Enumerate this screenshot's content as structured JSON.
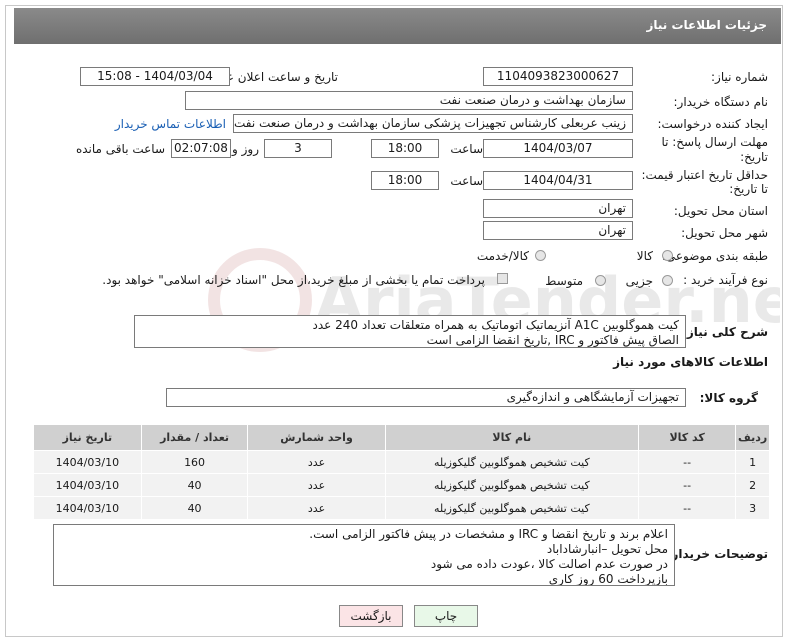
{
  "header": {
    "title": "جزئیات اطلاعات نیاز"
  },
  "form": {
    "need_number_label": "شماره نیاز:",
    "need_number": "1104093823000627",
    "announce_label": "تاریخ و ساعت اعلان عمومی:",
    "announce_value": "1404/03/04 - 15:08",
    "buyer_org_label": "نام دستگاه خریدار:",
    "buyer_org": "سازمان بهداشت و درمان صنعت نفت",
    "creator_label": "ایجاد کننده درخواست:",
    "creator": "زینب عربعلی کارشناس تجهیزات پزشکی سازمان بهداشت و درمان صنعت نفت",
    "contact_link": "اطلاعات تماس خریدار",
    "deadline_label_1": "مهلت ارسال پاسخ: تا",
    "deadline_label_2": "تاریخ:",
    "deadline_date": "1404/03/07",
    "time_label": "ساعت",
    "deadline_time": "18:00",
    "days_value": "3",
    "days_label": "روز و",
    "remaining_value": "02:07:08",
    "remaining_label": "ساعت باقی مانده",
    "validity_label_1": "حداقل تاریخ اعتبار قیمت:",
    "validity_label_2": "تا تاریخ:",
    "validity_date": "1404/04/31",
    "validity_time": "18:00",
    "province_label": "استان محل تحویل:",
    "province": "تهران",
    "city_label": "شهر محل تحویل:",
    "city": "تهران",
    "category_label": "طبقه بندی موضوعی:",
    "category_options": [
      "کالا",
      "کالا/خدمت"
    ],
    "process_label": "نوع فرآیند خرید :",
    "process_options": [
      "جزیی",
      "متوسط"
    ],
    "payment_note": "پرداخت تمام یا بخشی از مبلغ خرید،از محل \"اسناد خزانه اسلامی\" خواهد بود."
  },
  "summary": {
    "label": "شرح کلی نیاز:",
    "line1": "کیت هموگلوبین A1C  آنزیماتیک اتوماتیک به همراه متعلقات  تعداد 240 عدد",
    "line2": "الصاق پیش فاکتور و IRC ,تاریخ انقضا الزامی است"
  },
  "goods": {
    "section_title": "اطلاعات کالاهای مورد نیاز",
    "group_label": "گروه کالا:",
    "group_value": "تجهیزات آزمایشگاهی و اندازه‌گیری"
  },
  "table": {
    "headers": [
      "ردیف",
      "کد کالا",
      "نام کالا",
      "واحد شمارش",
      "تعداد / مقدار",
      "تاریخ نیاز"
    ],
    "rows": [
      [
        "1",
        "--",
        "کیت تشخیص هموگلوبین گلیکوزیله",
        "عدد",
        "160",
        "1404/03/10"
      ],
      [
        "2",
        "--",
        "کیت تشخیص هموگلوبین گلیکوزیله",
        "عدد",
        "40",
        "1404/03/10"
      ],
      [
        "3",
        "--",
        "کیت تشخیص هموگلوبین گلیکوزیله",
        "عدد",
        "40",
        "1404/03/10"
      ]
    ]
  },
  "buyer_notes": {
    "label": "توضیحات خریدار:",
    "lines": [
      "اعلام برند و تاریخ انقضا  و IRC  و مشخصات  در پیش فاکتور الزامی است.",
      "محل تحویل –انبارشاداباد",
      "در صورت عدم اصالت کالا ،عودت داده می شود",
      "بازپرداخت 60 روز کاری"
    ]
  },
  "buttons": {
    "print": "چاپ",
    "back": "بازگشت"
  },
  "watermark": {
    "text": "AriaTender.neT"
  }
}
